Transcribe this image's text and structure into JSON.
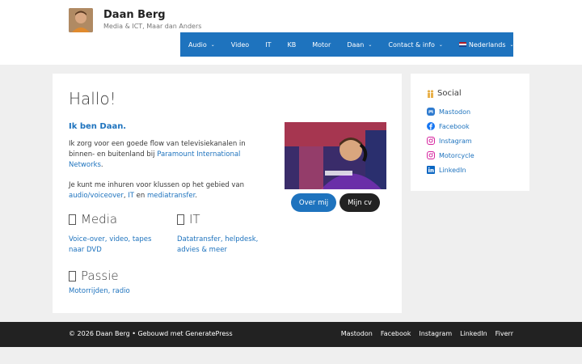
{
  "header": {
    "site_title": "Daan Berg",
    "site_description": "Media & ICT, Maar dan Anders"
  },
  "nav": {
    "items": [
      {
        "label": "Audio",
        "dropdown": true
      },
      {
        "label": "Video",
        "dropdown": false
      },
      {
        "label": "IT",
        "dropdown": false
      },
      {
        "label": "KB",
        "dropdown": false
      },
      {
        "label": "Motor",
        "dropdown": false
      },
      {
        "label": "Daan",
        "dropdown": true
      },
      {
        "label": "Contact & info",
        "dropdown": true
      },
      {
        "label": "Nederlands",
        "dropdown": true,
        "icon": "dutch-flag-icon"
      }
    ],
    "background": "#1e73be"
  },
  "main": {
    "title": "Hallo!",
    "intro": "Ik ben Daan.",
    "p1_text": "Ik zorg voor een goede flow van televisiekanalen in binnen- en buitenland bij ",
    "p1_link": "Paramount International Networks",
    "p1_end": ".",
    "p2_text": "Je kunt me inhuren voor klussen op het gebied van ",
    "p2_link1": "audio/voiceover",
    "p2_sep": ", ",
    "p2_link2": "IT",
    "p2_and": " en ",
    "p2_link3": "mediatransfer",
    "p2_end": ".",
    "buttons": {
      "about": "Over mij",
      "cv": "Mijn cv"
    },
    "sections": {
      "media": {
        "title": "Media",
        "links": "Voice-over, video, tapes naar DVD"
      },
      "it": {
        "title": "IT",
        "links": "Datatransfer, helpdesk, advies & meer"
      },
      "passie": {
        "title": "Passie",
        "links": "Motorrijden, radio"
      }
    }
  },
  "sidebar": {
    "title": "Social",
    "links": [
      {
        "label": "Mastodon",
        "icon": "mastodon-icon",
        "color": "#2f7bcf"
      },
      {
        "label": "Facebook",
        "icon": "facebook-icon",
        "color": "#1877f2"
      },
      {
        "label": "Instagram",
        "icon": "instagram-icon",
        "color": "#d6249f"
      },
      {
        "label": "Motorcycle",
        "icon": "instagram-icon",
        "color": "#d6249f"
      },
      {
        "label": "LinkedIn",
        "icon": "linkedin-icon",
        "color": "#0a66c2"
      }
    ]
  },
  "footer": {
    "copyright": "© 2026 Daan Berg • Gebouwd met GeneratePress",
    "links": [
      "Mastodon",
      "Facebook",
      "Instagram",
      "LinkedIn",
      "Fiverr"
    ]
  }
}
